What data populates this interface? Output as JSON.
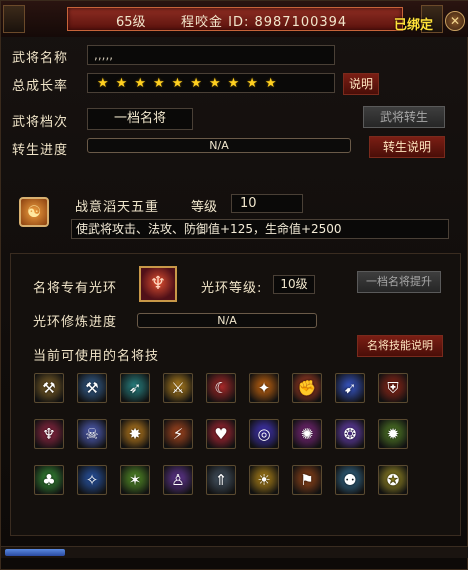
{
  "title": {
    "level": "65级",
    "name_id": "程咬金 ID: 8987100394",
    "bind_status": "已绑定"
  },
  "general": {
    "name_label": "武将名称",
    "name_value": ",,,,,",
    "growth_label": "总成长率",
    "stars_filled": 10,
    "stars_total": 10,
    "growth_help_button": "说明",
    "tier_label": "武将档次",
    "tier_value": "一档名将",
    "rebirth_button": "武将转生",
    "rebirth_progress_label": "转生进度",
    "rebirth_progress_value": "N/A",
    "rebirth_help_button": "转生说明"
  },
  "skill_info": {
    "name": "战意滔天五重",
    "level_label": "等级",
    "level_value": "10",
    "description": "使武将攻击、法攻、防御值+125，生命值+2500"
  },
  "aura": {
    "label": "名将专有光环",
    "level_label": "光环等级:",
    "level_value": "10级",
    "upgrade_button": "一档名将提升",
    "cultivation_label": "光环修炼进度",
    "cultivation_value": "N/A",
    "usable_skills_label": "当前可使用的名将技",
    "skills_help_button": "名将技能说明"
  },
  "skills": [
    {
      "icon": "axe-icon",
      "color": "#8a6a2a"
    },
    {
      "icon": "hammer-icon",
      "color": "#3a6aa0"
    },
    {
      "icon": "arrow-shot-icon",
      "color": "#2a8a8a"
    },
    {
      "icon": "sword-slash-icon",
      "color": "#c08a20"
    },
    {
      "icon": "crescent-blade-icon",
      "color": "#b02a2a"
    },
    {
      "icon": "flame-slash-icon",
      "color": "#d06a10"
    },
    {
      "icon": "fire-fist-icon",
      "color": "#d04a2a"
    },
    {
      "icon": "wind-arrow-icon",
      "color": "#3a5ad0"
    },
    {
      "icon": "shield-bash-icon",
      "color": "#a02a1a"
    },
    {
      "icon": "demon-wings-icon",
      "color": "#a02a4a"
    },
    {
      "icon": "ghost-icon",
      "color": "#5a6ad0"
    },
    {
      "icon": "burst-icon",
      "color": "#d08a20"
    },
    {
      "icon": "dragon-icon",
      "color": "#b04a20"
    },
    {
      "icon": "heart-icon",
      "color": "#c02a3a"
    },
    {
      "icon": "vortex-icon",
      "color": "#4a3ad0"
    },
    {
      "icon": "dark-aura-icon",
      "color": "#8a2a8a"
    },
    {
      "icon": "swirl-icon",
      "color": "#7a4ad0"
    },
    {
      "icon": "beast-icon",
      "color": "#5a8a2a"
    },
    {
      "icon": "nature-icon",
      "color": "#3a9a3a"
    },
    {
      "icon": "blue-aura-icon",
      "color": "#2a5ab0"
    },
    {
      "icon": "green-flame-icon",
      "color": "#5a9a2a"
    },
    {
      "icon": "purple-figure-icon",
      "color": "#6a3aa0"
    },
    {
      "icon": "arrow-up-icon",
      "color": "#4a5a6a"
    },
    {
      "icon": "golden-aura-icon",
      "color": "#c0901a"
    },
    {
      "icon": "rally-icon",
      "color": "#a04a1a"
    },
    {
      "icon": "crowd-icon",
      "color": "#3a7aa0"
    },
    {
      "icon": "glow-figure-icon",
      "color": "#b0a02a"
    }
  ],
  "scroll": {
    "position_fraction": 0.13
  }
}
